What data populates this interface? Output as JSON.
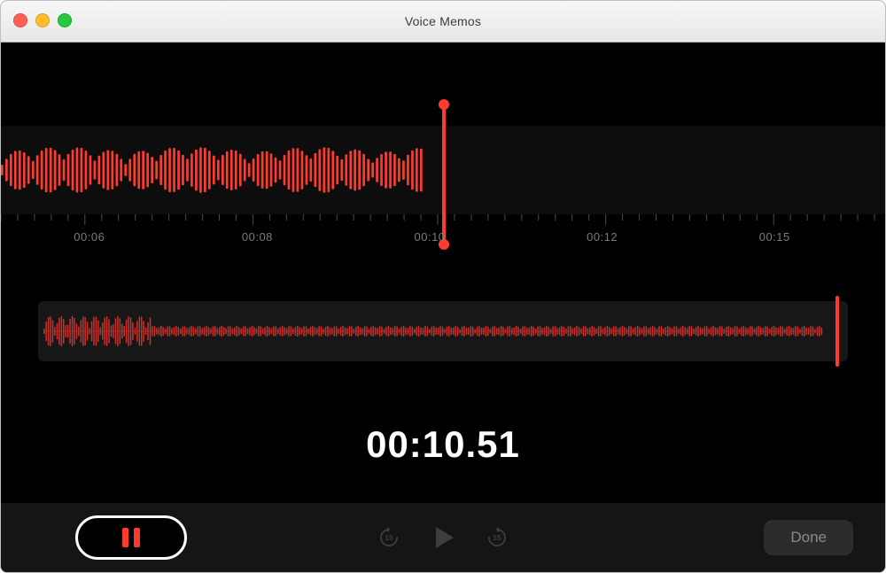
{
  "window": {
    "title": "Voice Memos"
  },
  "timeline": {
    "tick_labels": [
      "00:06",
      "00:08",
      "00:10",
      "00:12",
      "00:15"
    ]
  },
  "timecode": "00:10.51",
  "controls": {
    "done_label": "Done",
    "skip_seconds": "15"
  },
  "colors": {
    "accent": "#ff3b30"
  }
}
